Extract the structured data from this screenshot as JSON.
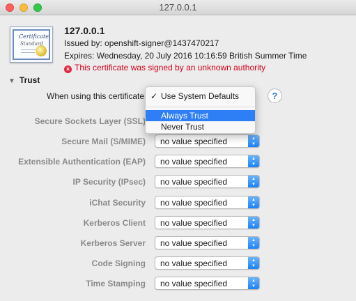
{
  "window": {
    "title": "127.0.0.1"
  },
  "certificate": {
    "icon_text_line1": "Certificate",
    "icon_text_line2": "Standard",
    "name": "127.0.0.1",
    "issued_by": "Issued by: openshift-signer@1437470217",
    "expires": "Expires: Wednesday, 20 July 2016 10:16:59 British Summer Time",
    "error": "This certificate was signed by an unknown authority",
    "error_icon": "x-circle-icon"
  },
  "trust": {
    "section_label": "Trust",
    "when_using_label": "When using this certificate:",
    "help_label": "?",
    "menu": {
      "checked_item": "Use System Defaults",
      "items": [
        "Always Trust",
        "Never Trust"
      ],
      "highlighted_index": 0
    },
    "rows": [
      {
        "label": "Secure Sockets Layer (SSL)",
        "value": ""
      },
      {
        "label": "Secure Mail (S/MIME)",
        "value": "no value specified"
      },
      {
        "label": "Extensible Authentication (EAP)",
        "value": "no value specified"
      },
      {
        "label": "IP Security (IPsec)",
        "value": "no value specified"
      },
      {
        "label": "iChat Security",
        "value": "no value specified"
      },
      {
        "label": "Kerberos Client",
        "value": "no value specified"
      },
      {
        "label": "Kerberos Server",
        "value": "no value specified"
      },
      {
        "label": "Code Signing",
        "value": "no value specified"
      },
      {
        "label": "Time Stamping",
        "value": "no value specified"
      }
    ]
  },
  "colors": {
    "accent": "#2e7ef6",
    "error": "#d0021b"
  }
}
